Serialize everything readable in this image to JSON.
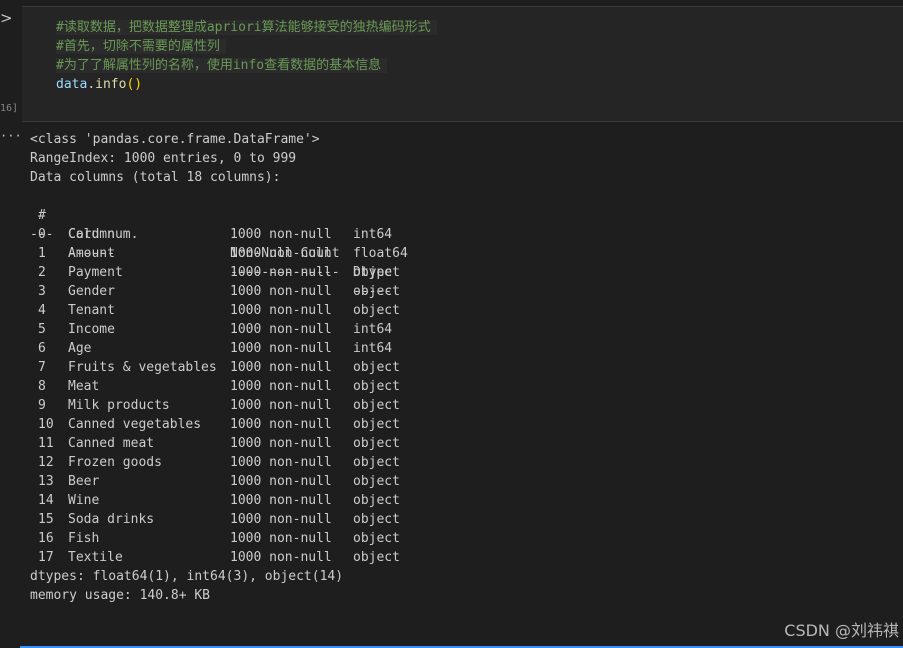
{
  "cell": {
    "exec_count": "16]",
    "out_marker": "···",
    "code_comments": [
      "#读取数据，把数据整理成apriori算法能够接受的独热编码形式",
      "#首先，切除不需要的属性列",
      "#为了了解属性列的名称，使用info查看数据的基本信息"
    ],
    "code_call": {
      "obj": "data",
      "dot": ".",
      "fn": "info",
      "parens": "()"
    }
  },
  "output": {
    "header_lines": [
      "<class 'pandas.core.frame.DataFrame'>",
      "RangeIndex: 1000 entries, 0 to 999",
      "Data columns (total 18 columns):"
    ],
    "table_header": {
      "idx": "#",
      "col": "Column",
      "count": "Non-Null Count",
      "dtype": "Dtype"
    },
    "table_rule": {
      "idx": "---",
      "col": "------",
      "count": "--------------",
      "dtype": "-----"
    },
    "rows": [
      {
        "idx": "0",
        "col": "Card num.",
        "count": "1000 non-null",
        "dtype": "int64"
      },
      {
        "idx": "1",
        "col": "Amount",
        "count": "1000 non-null",
        "dtype": "float64"
      },
      {
        "idx": "2",
        "col": "Payment",
        "count": "1000 non-null",
        "dtype": "object"
      },
      {
        "idx": "3",
        "col": "Gender",
        "count": "1000 non-null",
        "dtype": "object"
      },
      {
        "idx": "4",
        "col": "Tenant",
        "count": "1000 non-null",
        "dtype": "object"
      },
      {
        "idx": "5",
        "col": "Income",
        "count": "1000 non-null",
        "dtype": "int64"
      },
      {
        "idx": "6",
        "col": "Age",
        "count": "1000 non-null",
        "dtype": "int64"
      },
      {
        "idx": "7",
        "col": "Fruits & vegetables",
        "count": "1000 non-null",
        "dtype": "object"
      },
      {
        "idx": "8",
        "col": "Meat",
        "count": "1000 non-null",
        "dtype": "object"
      },
      {
        "idx": "9",
        "col": "Milk products",
        "count": "1000 non-null",
        "dtype": "object"
      },
      {
        "idx": "10",
        "col": "Canned vegetables",
        "count": "1000 non-null",
        "dtype": "object"
      },
      {
        "idx": "11",
        "col": "Canned meat",
        "count": "1000 non-null",
        "dtype": "object"
      },
      {
        "idx": "12",
        "col": "Frozen goods",
        "count": "1000 non-null",
        "dtype": "object"
      },
      {
        "idx": "13",
        "col": "Beer",
        "count": "1000 non-null",
        "dtype": "object"
      },
      {
        "idx": "14",
        "col": "Wine",
        "count": "1000 non-null",
        "dtype": "object"
      },
      {
        "idx": "15",
        "col": "Soda drinks",
        "count": "1000 non-null",
        "dtype": "object"
      },
      {
        "idx": "16",
        "col": "Fish",
        "count": "1000 non-null",
        "dtype": "object"
      },
      {
        "idx": "17",
        "col": "Textile",
        "count": "1000 non-null",
        "dtype": "object"
      }
    ],
    "footer_lines": [
      "dtypes: float64(1), int64(3), object(14)",
      "memory usage: 140.8+ KB"
    ]
  },
  "watermark": "CSDN @刘祎祺",
  "icons": {
    "expand": "chevron-right-icon"
  },
  "colors": {
    "background": "#1e1e1e",
    "cell": "#252526",
    "comment": "#6a9955",
    "focus": "#3794ff"
  }
}
